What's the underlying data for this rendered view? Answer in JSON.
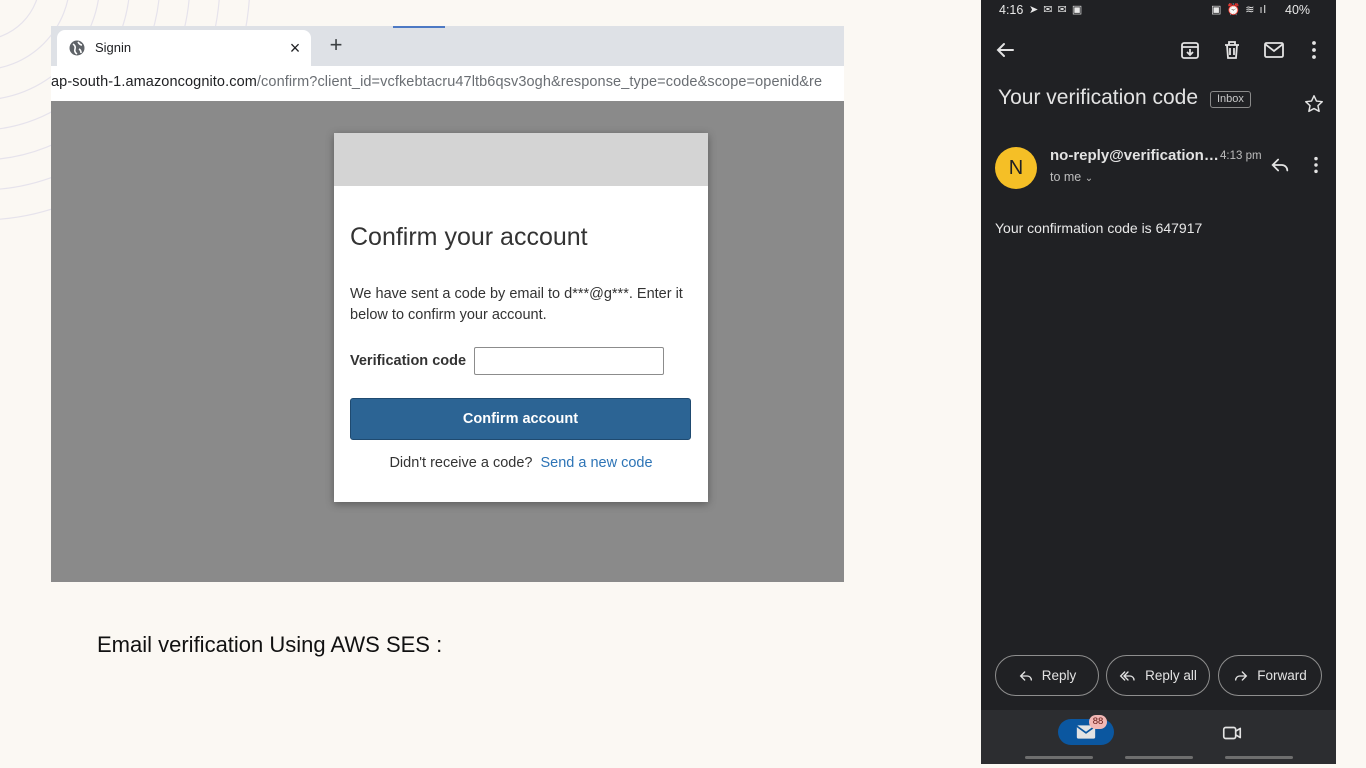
{
  "browser": {
    "tab_title": "Signin",
    "tab_close": "×",
    "new_tab": "+",
    "url_host": "ap-south-1.amazoncognito.com",
    "url_path": "/confirm?client_id=vcfkebtacru47ltb6qsv3ogh&response_type=code&scope=openid&re"
  },
  "modal": {
    "title": "Confirm your account",
    "description": "We have sent a code by email to d***@g***. Enter it below to confirm your account.",
    "code_label": "Verification code",
    "code_value": "",
    "confirm_button": "Confirm account",
    "resend_prompt": "Didn't receive a code?",
    "resend_link": "Send a new code"
  },
  "caption": "Email verification Using AWS SES :",
  "phone": {
    "status_time": "4:16",
    "battery": "40%",
    "subject": "Your verification code",
    "label_chip": "Inbox",
    "avatar_letter": "N",
    "sender": "no-reply@verification…",
    "sent_time": "4:13 pm",
    "recipient": "to me",
    "body": "Your confirmation code is 647917",
    "actions": {
      "reply": "Reply",
      "reply_all": "Reply all",
      "forward": "Forward"
    },
    "unread_badge": "88"
  },
  "icons": {
    "tab_favicon": "globe-icon",
    "back": "arrow-left-icon",
    "archive": "archive-icon",
    "delete": "trash-icon",
    "mark_unread": "envelope-icon",
    "more": "more-vertical-icon",
    "star": "star-icon",
    "reply": "reply-icon",
    "reply_all": "reply-all-icon",
    "forward": "forward-icon",
    "mail": "mail-icon",
    "meet": "video-icon"
  },
  "colors": {
    "confirm_button": "#2c6494",
    "link": "#2d74b6",
    "avatar": "#f5bf26",
    "phone_background": "#202124",
    "mail_pill": "#0b57a0"
  }
}
